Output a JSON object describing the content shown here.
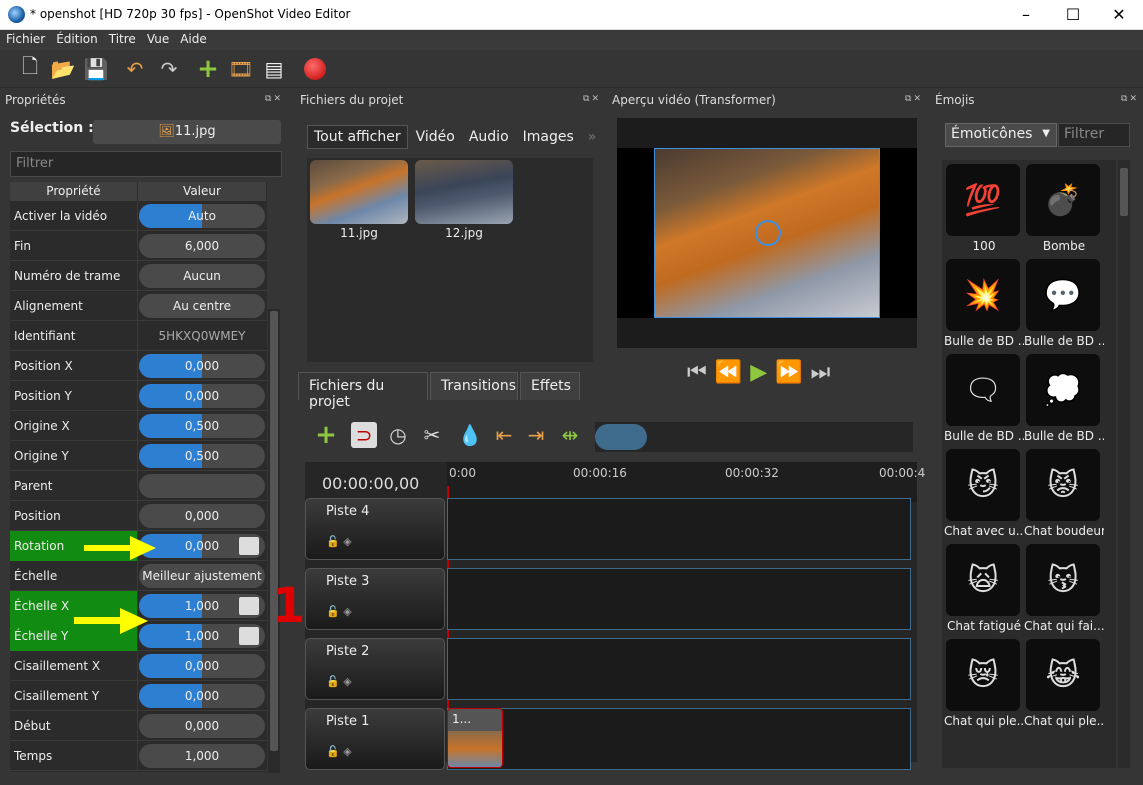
{
  "window": {
    "title": "* openshot [HD 720p 30 fps] - OpenShot Video Editor",
    "minimize": "–",
    "maximize": "☐",
    "close": "✕"
  },
  "menu": [
    "Fichier",
    "Édition",
    "Titre",
    "Vue",
    "Aide"
  ],
  "properties": {
    "panel_title": "Propriétés",
    "selection_label": "Sélection :",
    "selection_value": "11.jpg",
    "filter_placeholder": "Filtrer",
    "col_property": "Propriété",
    "col_value": "Valeur",
    "rows": [
      {
        "name": "Activer la vidéo",
        "value": "Auto",
        "fill": 0.5
      },
      {
        "name": "Fin",
        "value": "6,000",
        "fill": 0
      },
      {
        "name": "Numéro de trame",
        "value": "Aucun",
        "fill": 0
      },
      {
        "name": "Alignement",
        "value": "Au centre",
        "fill": 0
      },
      {
        "name": "Identifiant",
        "value": "5HKXQ0WMEY",
        "fill": 0
      },
      {
        "name": "Position X",
        "value": "0,000",
        "fill": 0.5
      },
      {
        "name": "Position Y",
        "value": "0,000",
        "fill": 0.5
      },
      {
        "name": "Origine X",
        "value": "0,500",
        "fill": 0.5
      },
      {
        "name": "Origine Y",
        "value": "0,500",
        "fill": 0.5
      },
      {
        "name": "Parent",
        "value": "",
        "fill": 0
      },
      {
        "name": "Position",
        "value": "0,000",
        "fill": 0
      },
      {
        "name": "Rotation",
        "value": "0,000",
        "fill": 0.5
      },
      {
        "name": "Échelle",
        "value": "Meilleur ajustement",
        "fill": 0
      },
      {
        "name": "Échelle X",
        "value": "1,000",
        "fill": 0.5
      },
      {
        "name": "Échelle Y",
        "value": "1,000",
        "fill": 0.5
      },
      {
        "name": "Cisaillement X",
        "value": "0,000",
        "fill": 0.5
      },
      {
        "name": "Cisaillement Y",
        "value": "0,000",
        "fill": 0.5
      },
      {
        "name": "Début",
        "value": "0,000",
        "fill": 0
      },
      {
        "name": "Temps",
        "value": "1,000",
        "fill": 0
      }
    ],
    "annotation": "1"
  },
  "files": {
    "panel_title": "Fichiers du projet",
    "tabs": [
      "Tout afficher",
      "Vidéo",
      "Audio",
      "Images"
    ],
    "more": "»",
    "items": [
      "11.jpg",
      "12.jpg"
    ],
    "bottom_tabs": [
      "Fichiers du projet",
      "Transitions",
      "Effets"
    ]
  },
  "preview": {
    "panel_title": "Aperçu vidéo (Transformer)"
  },
  "emojis": {
    "panel_title": "Émojis",
    "dropdown": "Émoticônes",
    "filter_placeholder": "Filtrer",
    "items": [
      {
        "label": "100",
        "glyph": "💯"
      },
      {
        "label": "Bombe",
        "glyph": "💣"
      },
      {
        "label": "Bulle de BD ...",
        "glyph": "💥"
      },
      {
        "label": "Bulle de BD ...",
        "glyph": "💬"
      },
      {
        "label": "Bulle de BD ...",
        "glyph": "🗨"
      },
      {
        "label": "Bulle de BD ...",
        "glyph": "💭"
      },
      {
        "label": "Chat avec u...",
        "glyph": "😼"
      },
      {
        "label": "Chat boudeur",
        "glyph": "😾"
      },
      {
        "label": "Chat fatigué",
        "glyph": "🙀"
      },
      {
        "label": "Chat qui fai...",
        "glyph": "😽"
      },
      {
        "label": "Chat qui ple...",
        "glyph": "😿"
      },
      {
        "label": "Chat qui ple...",
        "glyph": "😹"
      }
    ]
  },
  "timeline": {
    "timecode": "00:00:00,00",
    "ruler": [
      "0:00",
      "00:00:16",
      "00:00:32",
      "00:00:4"
    ],
    "tracks": [
      "Piste 4",
      "Piste 3",
      "Piste 2",
      "Piste 1"
    ],
    "clip_label": "1..."
  },
  "colors": {
    "accent": "#2d7fd2",
    "highlight": "#118b11",
    "arrow": "#ffff00",
    "annotation": "#e00000"
  }
}
